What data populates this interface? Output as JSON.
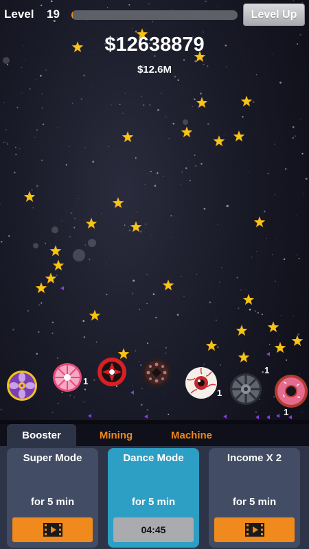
{
  "header": {
    "level_label": "Level",
    "level_value": "19",
    "level_progress": 0.01,
    "level_up_label": "Level Up"
  },
  "money": {
    "total": "$12638879",
    "rate": "$12.6M"
  },
  "machines": [
    {
      "name": "purple-flower-wheel",
      "count": ""
    },
    {
      "name": "pink-pinwheel",
      "count": "1"
    },
    {
      "name": "red-black-spinner",
      "count": ""
    },
    {
      "name": "dark-donut",
      "count": ""
    },
    {
      "name": "eyeball",
      "count": "1"
    },
    {
      "name": "grey-turbine",
      "count": "1"
    },
    {
      "name": "red-donut",
      "count": "1"
    }
  ],
  "tabs": [
    {
      "label": "Booster",
      "active": true
    },
    {
      "label": "Mining",
      "active": false
    },
    {
      "label": "Machine",
      "active": false
    }
  ],
  "boosters": [
    {
      "title": "Super Mode",
      "duration": "for 5 min",
      "button": "film-icon",
      "active": false
    },
    {
      "title": "Dance Mode",
      "duration": "for 5 min",
      "button_text": "04:45",
      "active": true
    },
    {
      "title": "Income X 2",
      "duration": "for 5 min",
      "button": "film-icon",
      "active": false
    }
  ],
  "colors": {
    "accent_orange": "#f08a1c",
    "active_card": "#2d9ec4",
    "card": "#424c64",
    "panel": "#2e3448",
    "star": "#f5c518"
  }
}
